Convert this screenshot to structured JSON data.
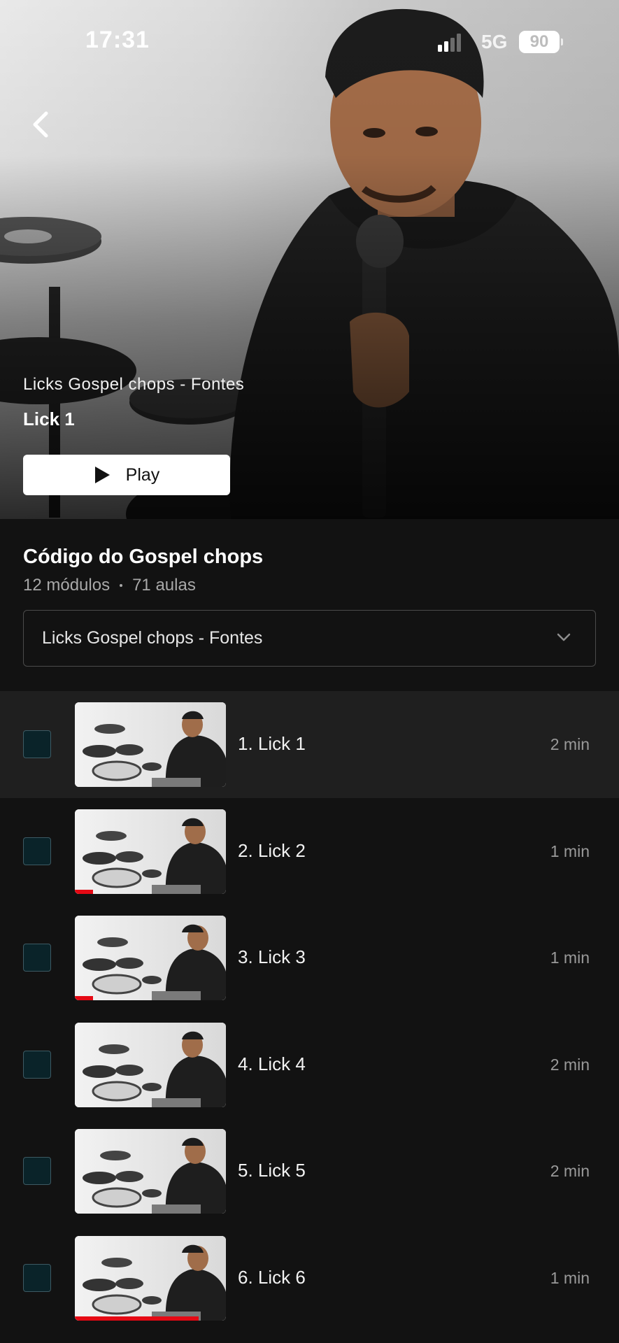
{
  "status_bar": {
    "time": "17:31",
    "network": "5G",
    "battery": "90"
  },
  "hero": {
    "subtitle": "Licks Gospel chops - Fontes",
    "title": "Lick 1",
    "play_label": "Play"
  },
  "course": {
    "title": "Código do Gospel chops",
    "modules": "12 módulos",
    "lessons": "71 aulas"
  },
  "module_select": {
    "value": "Licks Gospel chops - Fontes"
  },
  "lessons": [
    {
      "title": "1. Lick 1",
      "duration": "2 min",
      "progress": 0,
      "active": true
    },
    {
      "title": "2. Lick 2",
      "duration": "1 min",
      "progress": 0.12,
      "active": false
    },
    {
      "title": "3. Lick 3",
      "duration": "1 min",
      "progress": 0.12,
      "active": false
    },
    {
      "title": "4. Lick 4",
      "duration": "2 min",
      "progress": 0,
      "active": false
    },
    {
      "title": "5. Lick 5",
      "duration": "2 min",
      "progress": 0,
      "active": false
    },
    {
      "title": "6. Lick 6",
      "duration": "1 min",
      "progress": 0.82,
      "active": false
    }
  ],
  "colors": {
    "progress": "#e50914",
    "checkbox_fill": "#0a2329",
    "background": "#121212"
  }
}
